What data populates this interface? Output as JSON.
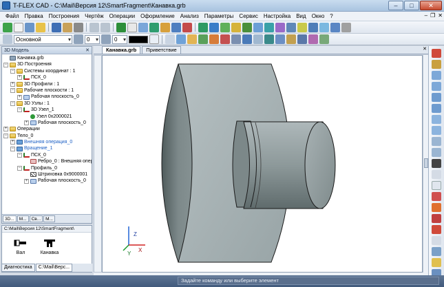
{
  "window": {
    "title": "T-FLEX CAD - C:\\Mail\\Версия 12\\SmartFragment\\Канавка.grb",
    "minimize": "–",
    "maximize": "□",
    "close": "✕"
  },
  "menu": {
    "items": [
      "Файл",
      "Правка",
      "Построения",
      "Чертёж",
      "Операции",
      "Оформление",
      "Анализ",
      "Параметры",
      "Сервис",
      "Настройка",
      "Вид",
      "Окно",
      "?"
    ],
    "mdi_min": "–",
    "mdi_restore": "❐",
    "mdi_close": "✕"
  },
  "toolbar2": {
    "layer_combo": "Основной",
    "line_width": "0",
    "line_type": "0"
  },
  "left_panel": {
    "title": "3D Модель",
    "close": "✕",
    "tree": [
      {
        "indent": 0,
        "exp": "",
        "icon": "body",
        "label": "Канавка.grb"
      },
      {
        "indent": 0,
        "exp": "−",
        "icon": "folder",
        "label": "3D Построения"
      },
      {
        "indent": 1,
        "exp": "−",
        "icon": "folder",
        "label": "Системы координат : 1"
      },
      {
        "indent": 2,
        "exp": "+",
        "icon": "axis",
        "label": "ПСК_0"
      },
      {
        "indent": 1,
        "exp": "+",
        "icon": "folder",
        "label": "3D Профили : 1"
      },
      {
        "indent": 1,
        "exp": "−",
        "icon": "folder",
        "label": "Рабочие плоскости : 1"
      },
      {
        "indent": 2,
        "exp": "+",
        "icon": "plane",
        "label": "Рабочая плоскость_0"
      },
      {
        "indent": 1,
        "exp": "−",
        "icon": "folder",
        "label": "3D Узлы : 1"
      },
      {
        "indent": 2,
        "exp": "−",
        "icon": "axis",
        "label": "3D Узел_1"
      },
      {
        "indent": 3,
        "exp": "",
        "icon": "node",
        "label": "Узел 0x2000021"
      },
      {
        "indent": 3,
        "exp": "+",
        "icon": "plane",
        "label": "Рабочая плоскость_0"
      },
      {
        "indent": 0,
        "exp": "+",
        "icon": "folder",
        "label": "Операции"
      },
      {
        "indent": 0,
        "exp": "−",
        "icon": "folder",
        "label": "Тело_0"
      },
      {
        "indent": 1,
        "exp": "+",
        "icon": "op",
        "label": "Внешняя операция_0",
        "blue": true
      },
      {
        "indent": 1,
        "exp": "−",
        "icon": "op",
        "label": "Вращение_1",
        "blue": true
      },
      {
        "indent": 2,
        "exp": "−",
        "icon": "axis",
        "label": "ПСК_0"
      },
      {
        "indent": 3,
        "exp": "",
        "icon": "rib",
        "label": "Ребро_0 : Внешняя опер"
      },
      {
        "indent": 2,
        "exp": "−",
        "icon": "axis",
        "label": "Профиль_0"
      },
      {
        "indent": 3,
        "exp": "",
        "icon": "hatch",
        "label": "Штриховка 0x9000001"
      },
      {
        "indent": 3,
        "exp": "+",
        "icon": "plane",
        "label": "Рабочая плоскость_0"
      }
    ],
    "tabs": [
      "3D...",
      "М...",
      "Св...",
      "М..."
    ]
  },
  "library": {
    "path": "C:\\Mail\\Версия 12\\SmartFragment\\",
    "items": [
      {
        "label": "Вал"
      },
      {
        "label": "Канавка"
      }
    ]
  },
  "bottom_tabs": [
    "Диагностика",
    "C:\\Mail\\Верс..."
  ],
  "doc_tabs": {
    "tabs": [
      "Канавка.grb",
      "Приветствие"
    ],
    "close": "✕"
  },
  "viewport": {
    "axis_x": "X",
    "axis_y": "Y",
    "axis_z": "Z"
  },
  "status": {
    "prompt": "Задайте команду или выберите элемент"
  },
  "colors": {
    "part_light": "#a9b3b5",
    "part_dark": "#5f6b6c",
    "titlebar": "#b9cfe7"
  }
}
